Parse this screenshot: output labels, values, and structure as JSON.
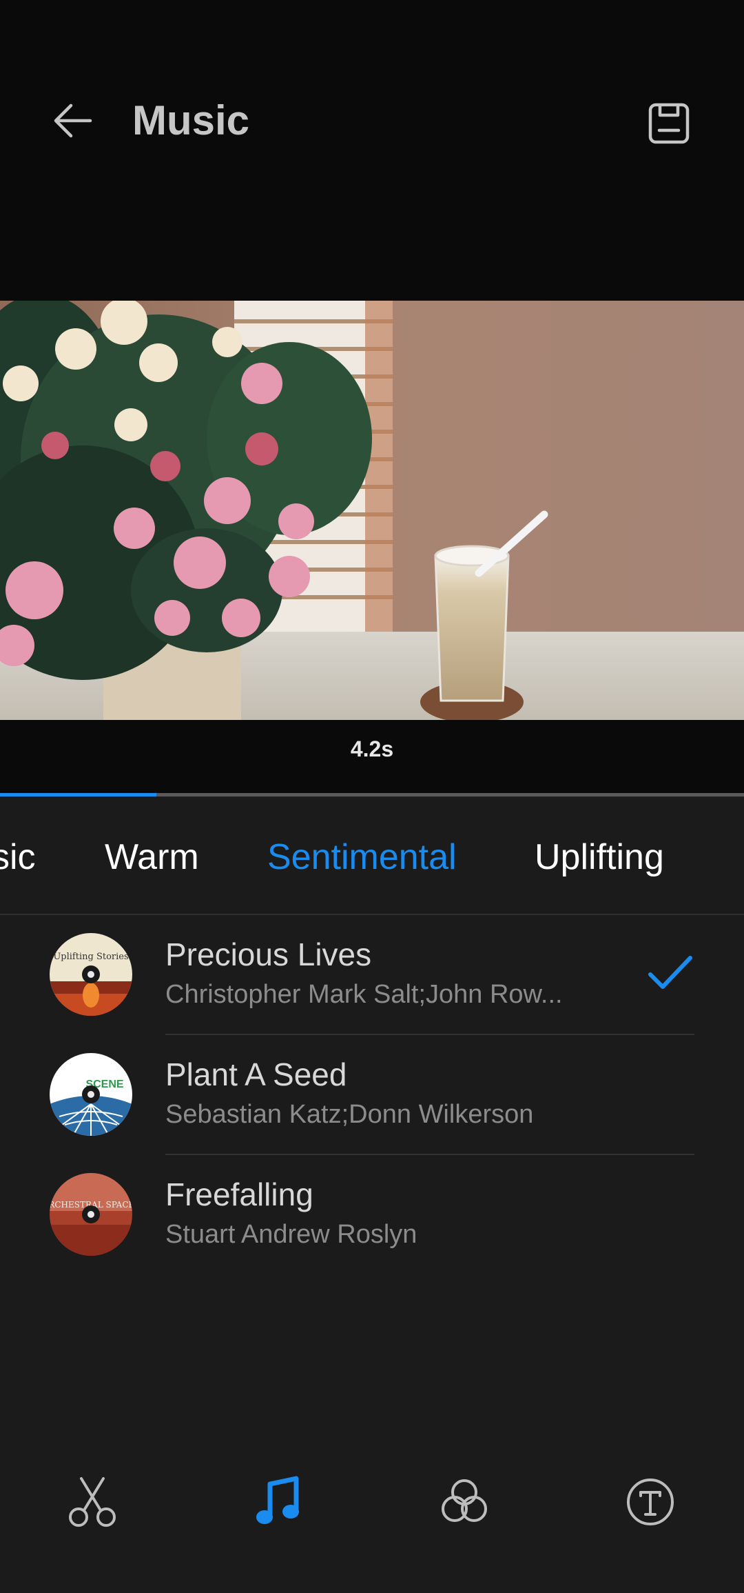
{
  "header": {
    "title": "Music",
    "back_icon": "arrow-left-icon",
    "save_icon": "save-icon"
  },
  "preview": {
    "time_label": "4.2s",
    "progress_fraction": 0.21
  },
  "categories": [
    {
      "label": "sic",
      "active": false
    },
    {
      "label": "Warm",
      "active": false
    },
    {
      "label": "Sentimental",
      "active": true
    },
    {
      "label": "Uplifting",
      "active": false
    }
  ],
  "tracks": [
    {
      "title": "Precious Lives",
      "artist": "Christopher Mark Salt;John  Row...",
      "selected": true,
      "cover_text": "Uplifting Stories"
    },
    {
      "title": "Plant A Seed",
      "artist": "Sebastian  Katz;Donn  Wilkerson",
      "selected": false,
      "cover_text": "SCENE"
    },
    {
      "title": "Freefalling",
      "artist": "Stuart Andrew Roslyn",
      "selected": false,
      "cover_text": "ORCHESTRAL SPACES"
    }
  ],
  "bottom_nav": [
    {
      "name": "trim",
      "icon": "scissors-icon",
      "active": false
    },
    {
      "name": "music",
      "icon": "music-note-icon",
      "active": true
    },
    {
      "name": "filters",
      "icon": "filters-icon",
      "active": false
    },
    {
      "name": "text",
      "icon": "text-icon",
      "active": false
    }
  ],
  "colors": {
    "accent": "#1a8cf0",
    "background": "#1b1b1c",
    "header_background": "#0a0a0b"
  }
}
